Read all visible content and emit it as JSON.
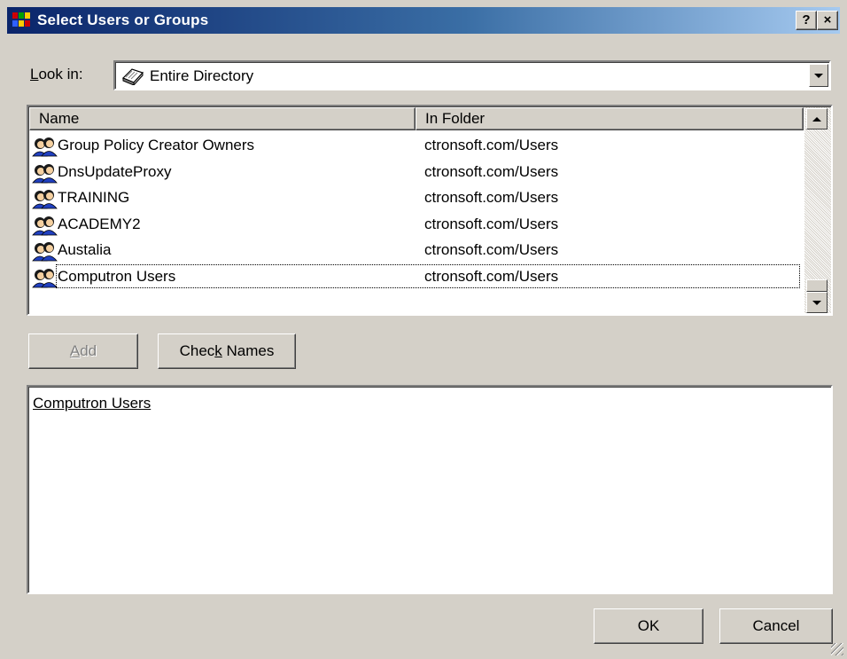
{
  "window": {
    "title": "Select Users or Groups",
    "help_button": "?",
    "close_button": "×"
  },
  "look_in": {
    "label_prefix": "L",
    "label_rest": "ook in:",
    "value": "Entire Directory"
  },
  "list": {
    "columns": [
      "Name",
      "In Folder"
    ],
    "rows": [
      {
        "name": "Group Policy Creator Owners",
        "folder": "ctronsoft.com/Users"
      },
      {
        "name": "DnsUpdateProxy",
        "folder": "ctronsoft.com/Users"
      },
      {
        "name": "TRAINING",
        "folder": "ctronsoft.com/Users"
      },
      {
        "name": "ACADEMY2",
        "folder": "ctronsoft.com/Users"
      },
      {
        "name": "Austalia",
        "folder": "ctronsoft.com/Users"
      },
      {
        "name": "Computron Users",
        "folder": "ctronsoft.com/Users"
      }
    ],
    "focused_row": 5
  },
  "buttons": {
    "add_label_prefix": "A",
    "add_label_rest": "dd",
    "check_names_prefix": "Chec",
    "check_names_mnemonic": "k",
    "check_names_rest": " Names",
    "ok_label": "OK",
    "cancel_label": "Cancel"
  },
  "selected": {
    "names": "Computron Users"
  },
  "colors": {
    "titlebar_start": "#0a246a",
    "titlebar_end": "#a6caf0",
    "face": "#d4d0c8"
  },
  "icons": {
    "app": "network-app-icon",
    "look_in": "directory-book-icon",
    "group": "group-icon"
  }
}
